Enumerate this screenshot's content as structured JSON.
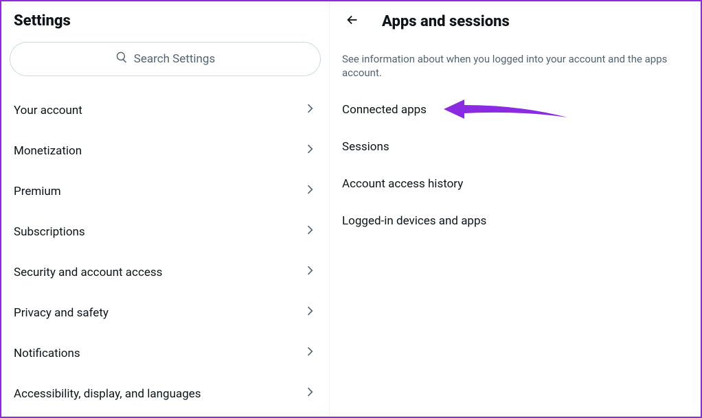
{
  "left": {
    "title": "Settings",
    "search_placeholder": "Search Settings",
    "items": [
      {
        "label": "Your account"
      },
      {
        "label": "Monetization"
      },
      {
        "label": "Premium"
      },
      {
        "label": "Subscriptions"
      },
      {
        "label": "Security and account access"
      },
      {
        "label": "Privacy and safety"
      },
      {
        "label": "Notifications"
      },
      {
        "label": "Accessibility, display, and languages"
      }
    ]
  },
  "right": {
    "title": "Apps and sessions",
    "description": "See information about when you logged into your account and the apps account.",
    "items": [
      {
        "label": "Connected apps"
      },
      {
        "label": "Sessions"
      },
      {
        "label": "Account access history"
      },
      {
        "label": "Logged-in devices and apps"
      }
    ]
  },
  "annotation": {
    "color": "#8a2be2"
  }
}
